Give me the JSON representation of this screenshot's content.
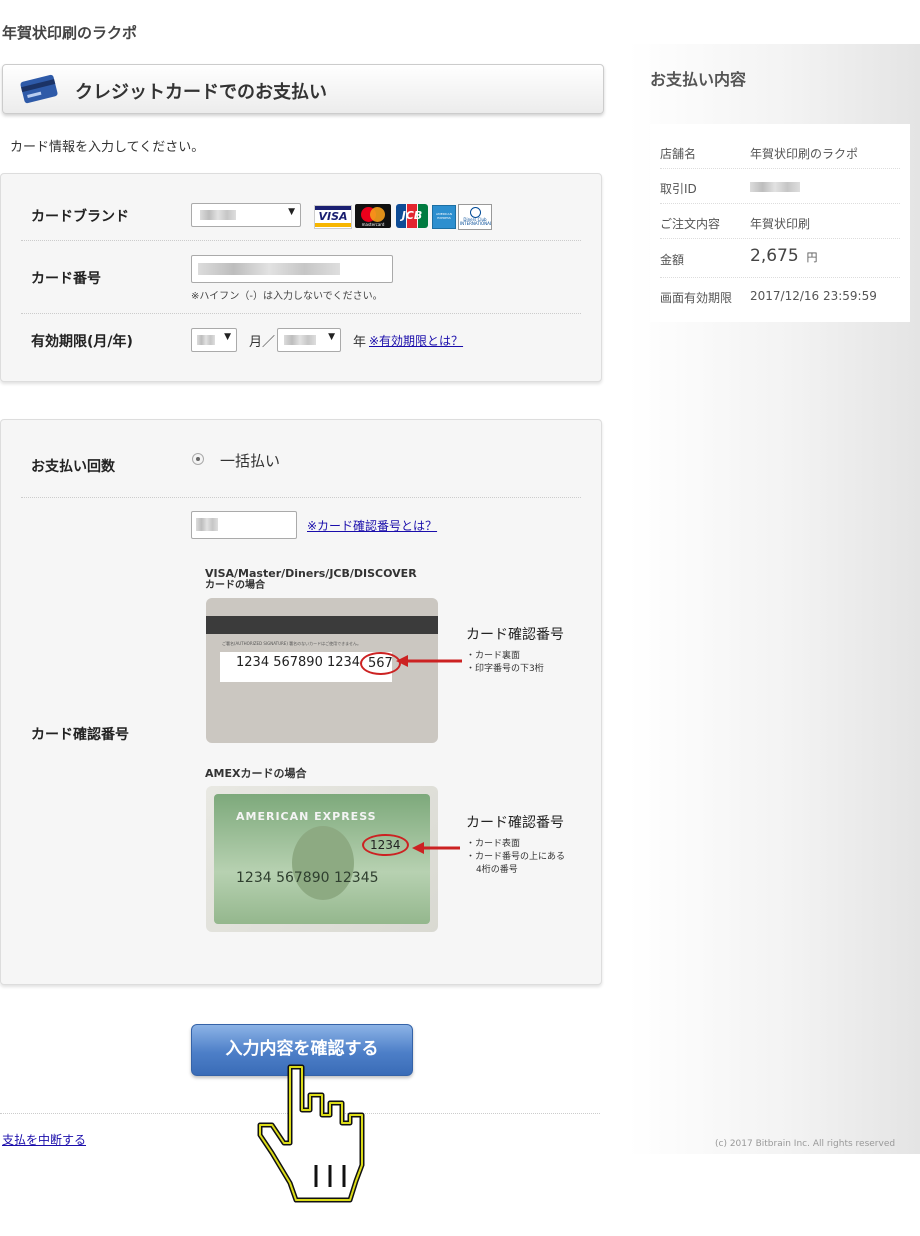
{
  "header": {
    "shop_title": "年賀状印刷のラクポ"
  },
  "section_title": "クレジットカードでのお支払い",
  "instructions": "カード情報を入力してください。",
  "card_form": {
    "brand": {
      "label": "カードブランド",
      "logos": [
        "VISA",
        "mastercard",
        "JCB",
        "AMERICAN EXPRESS",
        "Diners Club INTERNATIONAL"
      ]
    },
    "number": {
      "label": "カード番号",
      "note": "※ハイフン（-）は入力しないでください。"
    },
    "expiry": {
      "label": "有効期限(月/年)",
      "month_unit": "月／",
      "year_unit": "年",
      "help_link": "※有効期限とは？"
    }
  },
  "payment_form": {
    "count": {
      "label": "お支払い回数",
      "option": "一括払い"
    },
    "cvv": {
      "label": "カード確認番号",
      "help_link": "※カード確認番号とは？",
      "visa_caption_line1": "VISA/Master/Diners/JCB/DISCOVER",
      "visa_caption_line2": "カードの場合",
      "visa_card_tiny": "ご署名(AUTHORIZED SIGNATURE) 署名のないカードはご使用できません。",
      "visa_card_number": "1234 567890 1234",
      "visa_card_cvv": "567",
      "visa_note_title": "カード確認番号",
      "visa_note_1": "・カード裏面",
      "visa_note_2": "・印字番号の下3桁",
      "amex_caption": "AMEXカードの場合",
      "amex_card_brand": "AMERICAN EXPRESS",
      "amex_card_number": "1234 567890 12345",
      "amex_card_cvv": "1234",
      "amex_note_title": "カード確認番号",
      "amex_note_1": "・カード表面",
      "amex_note_2": "・カード番号の上にある",
      "amex_note_3": "4桁の番号"
    }
  },
  "actions": {
    "confirm_button": "入力内容を確認する",
    "cancel_link": "支払を中断する"
  },
  "summary": {
    "title": "お支払い内容",
    "rows": {
      "shop": {
        "key": "店舗名",
        "value": "年賀状印刷のラクポ"
      },
      "txn": {
        "key": "取引ID"
      },
      "order": {
        "key": "ご注文内容",
        "value": "年賀状印刷"
      },
      "amount": {
        "key": "金額",
        "value": "2,675",
        "unit": "円"
      },
      "expiry": {
        "key": "画面有効期限",
        "value": "2017/12/16 23:59:59"
      }
    }
  },
  "footer": {
    "copyright": "(c) 2017 Bitbrain Inc. All rights reserved"
  },
  "colors": {
    "accent_blue": "#4d7fc8",
    "link": "#1a0dab",
    "cvv_circle": "#cc2222"
  }
}
